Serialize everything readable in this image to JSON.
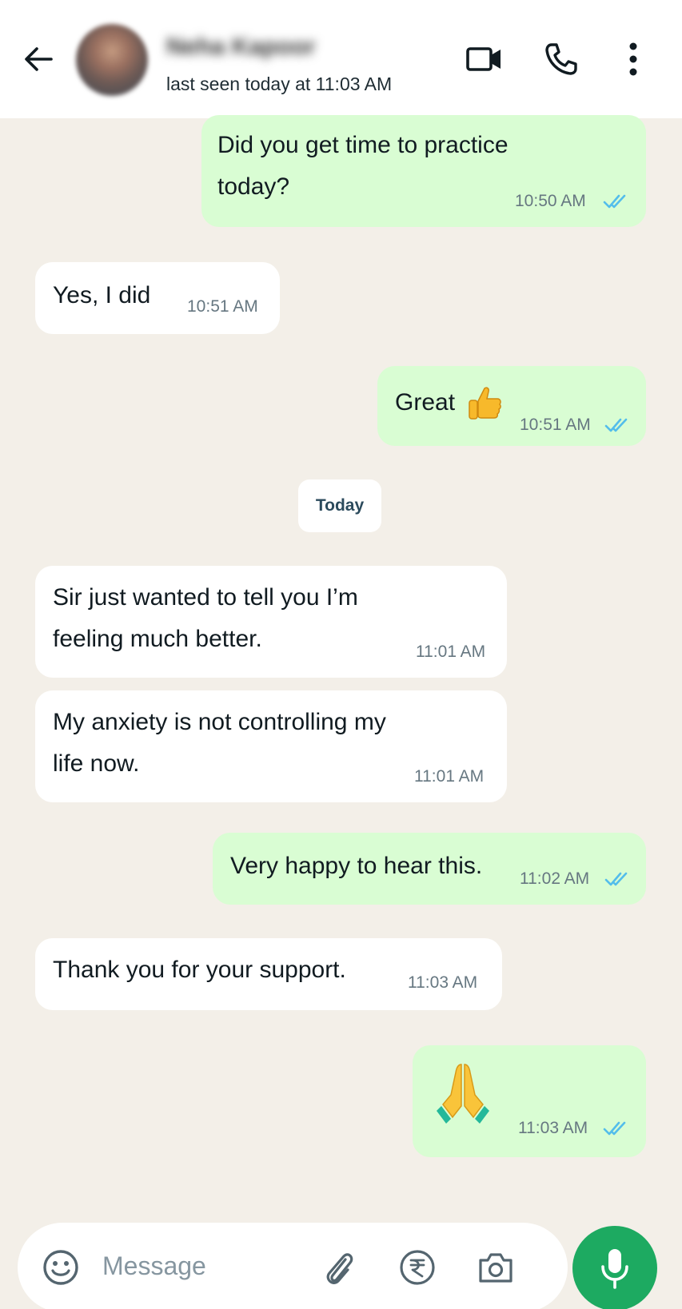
{
  "header": {
    "contact_name": "Neha Kapoor",
    "last_seen": "last seen today at 11:03 AM",
    "icons": [
      "back-arrow-icon",
      "video-call-icon",
      "voice-call-icon",
      "more-options-icon"
    ]
  },
  "chat": {
    "date_separator": "Today",
    "messages": [
      {
        "direction": "outgoing",
        "lines": [
          "Did you get time to practice",
          "today?"
        ],
        "time": "10:50 AM",
        "status": "read"
      },
      {
        "direction": "incoming",
        "lines": [
          "Yes, I did"
        ],
        "time": "10:51 AM"
      },
      {
        "direction": "outgoing",
        "lines": [
          "Great"
        ],
        "emoji": "thumbs-up",
        "time": "10:51 AM",
        "status": "read"
      },
      {
        "direction": "incoming",
        "lines": [
          "Sir just wanted to tell you I’m",
          "feeling much better."
        ],
        "time": "11:01 AM"
      },
      {
        "direction": "incoming",
        "lines": [
          "My anxiety is not controlling my",
          "life now."
        ],
        "time": "11:01 AM"
      },
      {
        "direction": "outgoing",
        "lines": [
          "Very happy to hear this."
        ],
        "time": "11:02 AM",
        "status": "read"
      },
      {
        "direction": "incoming",
        "lines": [
          "Thank you for your support."
        ],
        "time": "11:03 AM"
      },
      {
        "direction": "outgoing",
        "emoji": "folded-hands",
        "time": "11:03 AM",
        "status": "read"
      }
    ]
  },
  "composer": {
    "placeholder": "Message",
    "icons": [
      "emoji-icon",
      "attach-icon",
      "rupee-payment-icon",
      "camera-icon",
      "mic-icon"
    ]
  },
  "colors": {
    "outgoing_bubble": "#d9fdd3",
    "incoming_bubble": "#ffffff",
    "read_ticks": "#53bdeb",
    "accent_green": "#1daa61",
    "chat_background": "#f3efe8"
  }
}
